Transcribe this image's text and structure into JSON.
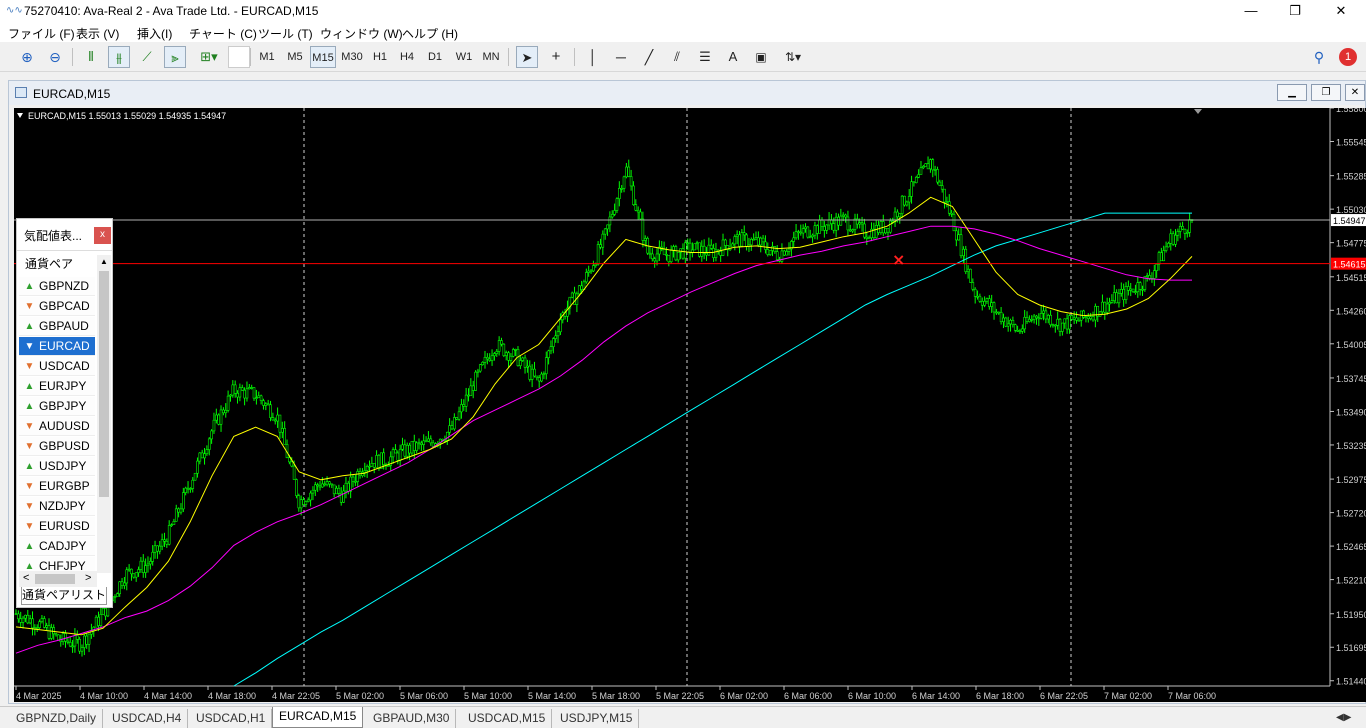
{
  "window": {
    "title": "75270410: Ava-Real 2 - Ava Trade Ltd. - EURCAD,M15",
    "minimize": "—",
    "restore": "❐",
    "close": "✕"
  },
  "menu": [
    "ファイル (F)",
    "表示 (V)",
    "挿入(I)",
    "チャート (C)",
    "ツール (T)",
    "ウィンドウ (W)",
    "ヘルプ (H)"
  ],
  "toolbar": {
    "timeframes": [
      "M1",
      "M5",
      "M15",
      "M30",
      "H1",
      "H4",
      "D1",
      "W1",
      "MN"
    ],
    "selected_timeframe": "M15",
    "text_tool": "A",
    "notification_count": "1"
  },
  "chart_window": {
    "title": "EURCAD,M15",
    "info": "EURCAD,M15  1.55013 1.55029 1.54935 1.54947"
  },
  "market_watch": {
    "title": "気配値表...",
    "close": "x",
    "column_header": "通貨ペア",
    "footer_tab": "通貨ペアリスト",
    "symbols": [
      {
        "name": "GBPNZD",
        "dir": "up"
      },
      {
        "name": "GBPCAD",
        "dir": "down"
      },
      {
        "name": "GBPAUD",
        "dir": "up"
      },
      {
        "name": "EURCAD",
        "dir": "down"
      },
      {
        "name": "USDCAD",
        "dir": "down"
      },
      {
        "name": "EURJPY",
        "dir": "up"
      },
      {
        "name": "GBPJPY",
        "dir": "up"
      },
      {
        "name": "AUDUSD",
        "dir": "down"
      },
      {
        "name": "GBPUSD",
        "dir": "down"
      },
      {
        "name": "USDJPY",
        "dir": "up"
      },
      {
        "name": "EURGBP",
        "dir": "down"
      },
      {
        "name": "NZDJPY",
        "dir": "down"
      },
      {
        "name": "EURUSD",
        "dir": "down"
      },
      {
        "name": "CADJPY",
        "dir": "up"
      },
      {
        "name": "CHFJPY",
        "dir": "up"
      }
    ],
    "selected": "EURCAD"
  },
  "tabs": [
    "GBPNZD,Daily",
    "USDCAD,H4",
    "USDCAD,H1",
    "EURCAD,M15",
    "GBPAUD,M30",
    "USDCAD,M15",
    "USDJPY,M15"
  ],
  "active_tab": "EURCAD,M15",
  "colors": {
    "candles": "#00ff00",
    "ma_fast": "#ffff00",
    "ma_mid": "#ff00ff",
    "ma_slow": "#00ffff",
    "bid_line": "#b0b0b0",
    "alert_line": "#ff0000",
    "marker": "#ff2020"
  },
  "chart_data": {
    "type": "line",
    "symbol": "EURCAD",
    "timeframe": "M15",
    "ylim": [
      1.514,
      1.558
    ],
    "y_ticks": [
      "1.55800",
      "1.55545",
      "1.55285",
      "1.55030",
      "1.54947",
      "1.54775",
      "1.54515",
      "1.54260",
      "1.54005",
      "1.53745",
      "1.53490",
      "1.53235",
      "1.52975",
      "1.52720",
      "1.52465",
      "1.52210",
      "1.51950",
      "1.51695",
      "1.51440"
    ],
    "y_tick_values": [
      1.558,
      1.55545,
      1.55285,
      1.5503,
      1.54947,
      1.54775,
      1.54515,
      1.5426,
      1.54005,
      1.53745,
      1.5349,
      1.53235,
      1.52975,
      1.5272,
      1.52465,
      1.5221,
      1.5195,
      1.51695,
      1.5144
    ],
    "x_ticks": [
      "4 Mar 2025",
      "4 Mar 10:00",
      "4 Mar 14:00",
      "4 Mar 18:00",
      "4 Mar 22:05",
      "5 Mar 02:00",
      "5 Mar 06:00",
      "5 Mar 10:00",
      "5 Mar 14:00",
      "5 Mar 18:00",
      "5 Mar 22:05",
      "6 Mar 02:00",
      "6 Mar 06:00",
      "6 Mar 10:00",
      "6 Mar 14:00",
      "6 Mar 18:00",
      "6 Mar 22:05",
      "7 Mar 02:00",
      "7 Mar 06:00"
    ],
    "bid": 1.54947,
    "bid_label": "1.54947",
    "alert_level": 1.54615,
    "alert_label": "1.54615",
    "price": [
      1.5195,
      1.5188,
      1.5175,
      1.5172,
      1.5195,
      1.5225,
      1.5232,
      1.5255,
      1.5295,
      1.5335,
      1.5365,
      1.5362,
      1.5345,
      1.528,
      1.5295,
      1.5285,
      1.531,
      1.5312,
      1.532,
      1.5325,
      1.5335,
      1.537,
      1.54,
      1.539,
      1.537,
      1.542,
      1.5445,
      1.548,
      1.5535,
      1.547,
      1.5468,
      1.5473,
      1.547,
      1.548,
      1.5478,
      1.5468,
      1.5485,
      1.549,
      1.5495,
      1.5485,
      1.549,
      1.5515,
      1.554,
      1.5495,
      1.544,
      1.5425,
      1.541,
      1.5425,
      1.5415,
      1.542,
      1.543,
      1.544,
      1.545,
      1.548,
      1.5494
    ],
    "ma_fast": [
      1.5185,
      1.5183,
      1.5181,
      1.5179,
      1.5184,
      1.52,
      1.5215,
      1.5235,
      1.5265,
      1.53,
      1.533,
      1.5337,
      1.533,
      1.5303,
      1.5297,
      1.53,
      1.5302,
      1.5308,
      1.5314,
      1.532,
      1.5328,
      1.5345,
      1.537,
      1.539,
      1.54,
      1.542,
      1.544,
      1.5462,
      1.548,
      1.5475,
      1.5472,
      1.547,
      1.547,
      1.5474,
      1.5475,
      1.5473,
      1.5474,
      1.5478,
      1.5482,
      1.5485,
      1.549,
      1.55,
      1.5512,
      1.5505,
      1.548,
      1.5455,
      1.5438,
      1.543,
      1.5425,
      1.5422,
      1.5423,
      1.5427,
      1.5435,
      1.545,
      1.5467
    ],
    "ma_mid": [
      1.5165,
      1.5171,
      1.5175,
      1.518,
      1.5185,
      1.5192,
      1.5197,
      1.5205,
      1.5216,
      1.523,
      1.5247,
      1.5257,
      1.5265,
      1.5271,
      1.5278,
      1.5286,
      1.5294,
      1.5302,
      1.531,
      1.532,
      1.5331,
      1.5342,
      1.535,
      1.5358,
      1.5366,
      1.5376,
      1.5388,
      1.5402,
      1.5414,
      1.5424,
      1.5432,
      1.544,
      1.5447,
      1.5454,
      1.546,
      1.5464,
      1.5468,
      1.5471,
      1.5475,
      1.5478,
      1.5482,
      1.5486,
      1.549,
      1.549,
      1.5488,
      1.5484,
      1.5479,
      1.5473,
      1.5468,
      1.5463,
      1.5458,
      1.5453,
      1.545,
      1.5449,
      1.5449
    ],
    "ma_slow": [
      null,
      null,
      null,
      null,
      null,
      null,
      null,
      null,
      null,
      null,
      1.514,
      1.515,
      1.5161,
      1.5171,
      1.5181,
      1.519,
      1.52,
      1.521,
      1.522,
      1.523,
      1.524,
      1.525,
      1.526,
      1.527,
      1.528,
      1.529,
      1.53,
      1.531,
      1.532,
      1.533,
      1.534,
      1.535,
      1.536,
      1.537,
      1.538,
      1.539,
      1.54,
      1.541,
      1.542,
      1.543,
      1.5438,
      1.5445,
      1.5452,
      1.546,
      1.5468,
      1.5475,
      1.548,
      1.5485,
      1.549,
      1.5495,
      1.55,
      1.55,
      1.55,
      1.55,
      1.55
    ],
    "marker_index": 40.5,
    "marker_price": 1.5465
  }
}
